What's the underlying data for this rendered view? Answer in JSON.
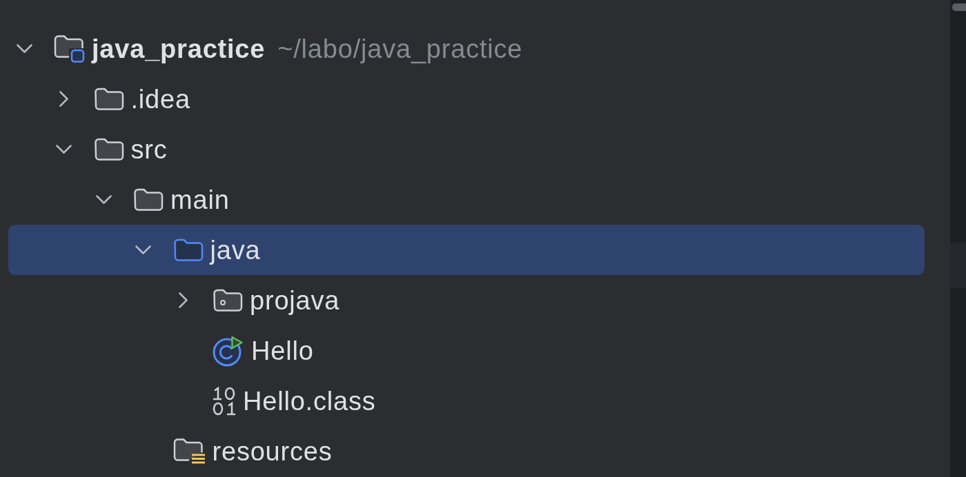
{
  "tree": [
    {
      "kind": "project",
      "label": "java_practice",
      "path": "~/labo/java_practice",
      "expanded": true,
      "selected": false,
      "children": [
        {
          "kind": "folder",
          "label": ".idea",
          "expanded": false,
          "selected": false
        },
        {
          "kind": "folder",
          "label": "src",
          "expanded": true,
          "selected": false,
          "children": [
            {
              "kind": "folder",
              "label": "main",
              "expanded": true,
              "selected": false,
              "children": [
                {
                  "kind": "source_root",
                  "label": "java",
                  "expanded": true,
                  "selected": true,
                  "children": [
                    {
                      "kind": "package",
                      "label": "projava",
                      "expanded": false,
                      "selected": false
                    },
                    {
                      "kind": "main_class",
                      "label": "Hello",
                      "selected": false
                    },
                    {
                      "kind": "class_file",
                      "label": "Hello.class",
                      "selected": false
                    }
                  ]
                },
                {
                  "kind": "resources_root",
                  "label": "resources",
                  "selected": false
                }
              ]
            }
          ]
        }
      ]
    }
  ]
}
